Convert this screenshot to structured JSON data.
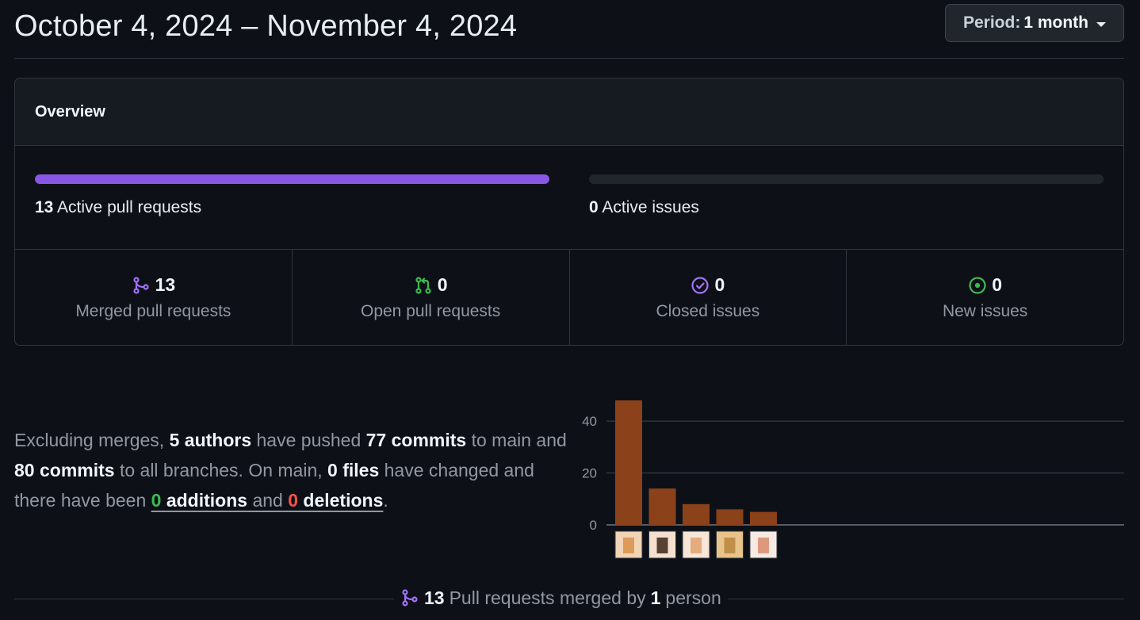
{
  "header": {
    "date_range": "October 4, 2024 – November 4, 2024",
    "period_label": "Period:",
    "period_value": "1 month"
  },
  "overview": {
    "title": "Overview",
    "active_prs": {
      "count": "13",
      "label": "Active pull requests",
      "fill_fraction": 1.0,
      "color": "#8957e5"
    },
    "active_issues": {
      "count": "0",
      "label": "Active issues",
      "fill_fraction": 0.0
    },
    "stats": [
      {
        "icon": "git-merge-icon",
        "count": "13",
        "label": "Merged pull requests",
        "color": "#a371f7"
      },
      {
        "icon": "git-pull-request-icon",
        "count": "0",
        "label": "Open pull requests",
        "color": "#3fb950"
      },
      {
        "icon": "issue-closed-icon",
        "count": "0",
        "label": "Closed issues",
        "color": "#a371f7"
      },
      {
        "icon": "issue-opened-icon",
        "count": "0",
        "label": "New issues",
        "color": "#3fb950"
      }
    ]
  },
  "summary": {
    "p1": "Excluding merges,",
    "authors": "5 authors",
    "p2": "have pushed",
    "commits_main": "77 commits",
    "p3": "to main and",
    "commits_all": "80 commits",
    "p4": "to all branches. On main,",
    "files": "0 files",
    "p5": "have changed and there have been",
    "additions_num": "0",
    "additions_word": "additions",
    "p6": "and",
    "deletions_num": "0",
    "deletions_word": "deletions",
    "p7": "."
  },
  "chart_data": {
    "type": "bar",
    "categories": [
      "author-1",
      "author-2",
      "author-3",
      "author-4",
      "author-5"
    ],
    "values": [
      48,
      14,
      8,
      6,
      5
    ],
    "ylim": [
      0,
      48
    ],
    "yticks": [
      0,
      20,
      40
    ],
    "bar_color": "#8b4119",
    "grid": true
  },
  "bottom": {
    "count": "13",
    "text1": "Pull requests merged by",
    "people": "1",
    "text2": "person"
  }
}
